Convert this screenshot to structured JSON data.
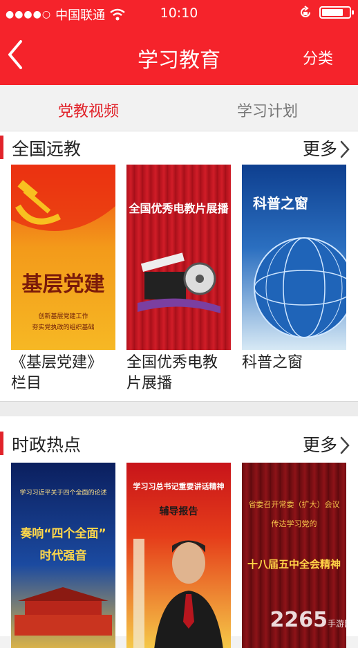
{
  "status_bar": {
    "signal_dots": "●●●●○",
    "carrier": "中国联通",
    "time": "10:10",
    "battery_level": 0.8
  },
  "nav": {
    "back_icon": "chevron-left",
    "title": "学习教育",
    "right_label": "分类"
  },
  "tabs": [
    {
      "label": "党教视频",
      "active": true
    },
    {
      "label": "学习计划",
      "active": false
    }
  ],
  "sections": [
    {
      "title": "全国远教",
      "more_label": "更多",
      "items": [
        {
          "caption": "《基层党建》栏目",
          "cover": {
            "main": "基层党建",
            "sub1": "创新基层党建工作",
            "sub2": "夯实党执政的组织基础"
          }
        },
        {
          "caption": "全国优秀电教片展播",
          "cover": {
            "main": "全国优秀电教片展播"
          }
        },
        {
          "caption": "科普之窗",
          "cover": {
            "main": "科普之窗"
          }
        }
      ]
    },
    {
      "title": "时政热点",
      "more_label": "更多",
      "items": [
        {
          "cover": {
            "top": "学习习近平关于四个全面的论述",
            "main1": "奏响“四个全面”",
            "main2": "时代强音"
          }
        },
        {
          "cover": {
            "top": "学习习总书记重要讲话精神",
            "main": "辅导报告"
          }
        },
        {
          "cover": {
            "top1": "省委召开常委（扩大）会议",
            "top2": "传达学习党的",
            "main": "十八届五中全会精神"
          }
        }
      ]
    }
  ],
  "watermark": {
    "text": "2265",
    "suffix": "手游网"
  },
  "colors": {
    "brand_red": "#f5232b",
    "accent_red": "#e1232a"
  }
}
